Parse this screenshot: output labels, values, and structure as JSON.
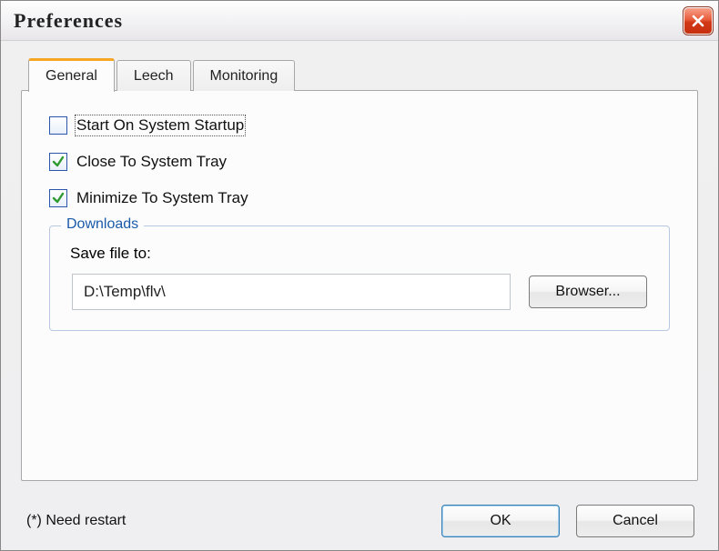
{
  "window": {
    "title": "Preferences"
  },
  "tabs": {
    "general": "General",
    "leech": "Leech",
    "monitoring": "Monitoring",
    "active": "general"
  },
  "options": {
    "start_on_startup": {
      "label": "Start On System Startup",
      "checked": false
    },
    "close_to_tray": {
      "label": "Close To System Tray",
      "checked": true
    },
    "minimize_to_tray": {
      "label": "Minimize To System Tray",
      "checked": true
    }
  },
  "downloads": {
    "legend": "Downloads",
    "save_label": "Save file to:",
    "path": "D:\\Temp\\flv\\",
    "browse_label": "Browser..."
  },
  "footer": {
    "note": "(*) Need restart",
    "ok": "OK",
    "cancel": "Cancel"
  }
}
